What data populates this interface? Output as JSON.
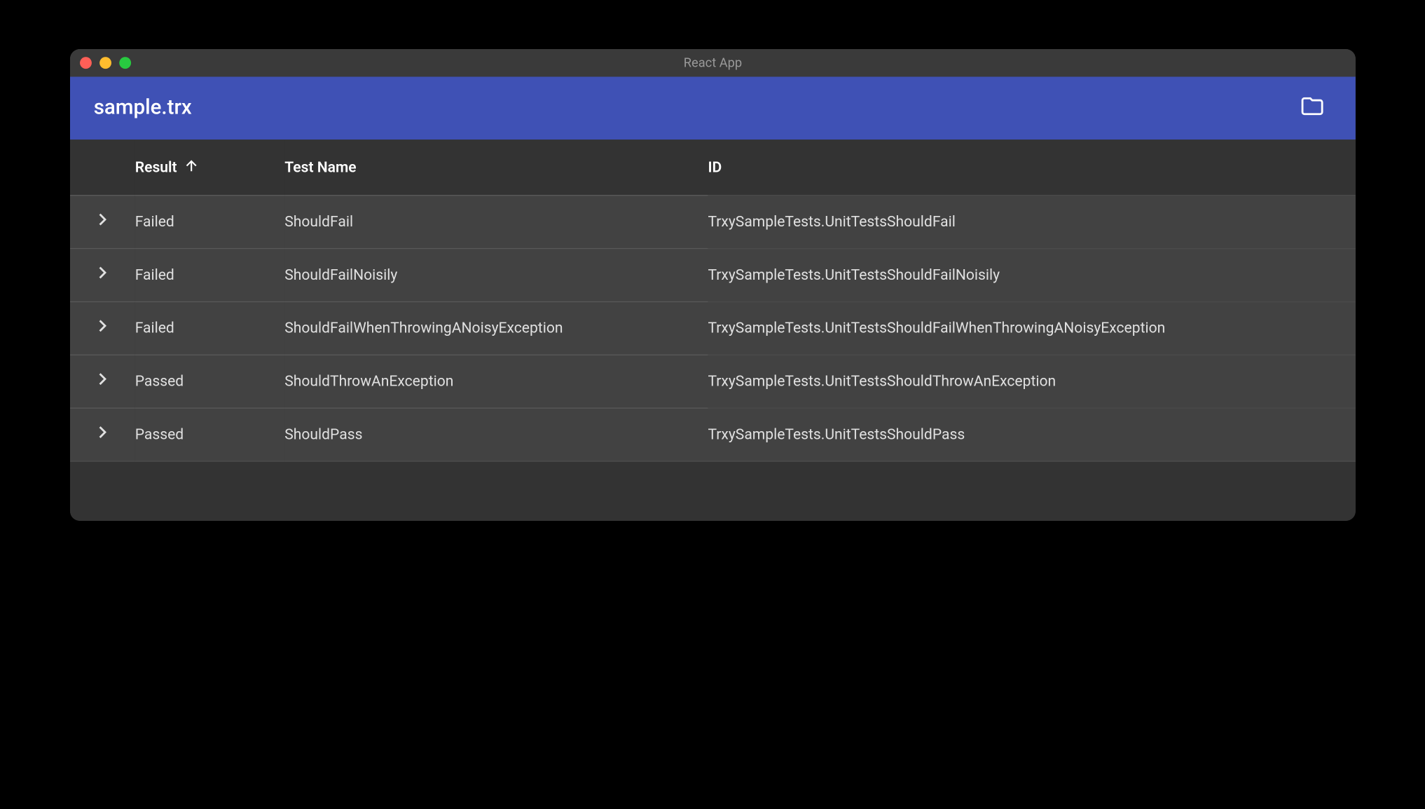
{
  "window": {
    "title": "React App"
  },
  "appbar": {
    "title": "sample.trx"
  },
  "table": {
    "columns": {
      "result": "Result",
      "testname": "Test Name",
      "id": "ID"
    },
    "rows": [
      {
        "result": "Failed",
        "testname": "ShouldFail",
        "id": "TrxySampleTests.UnitTestsShouldFail"
      },
      {
        "result": "Failed",
        "testname": "ShouldFailNoisily",
        "id": "TrxySampleTests.UnitTestsShouldFailNoisily"
      },
      {
        "result": "Failed",
        "testname": "ShouldFailWhenThrowingANoisyException",
        "id": "TrxySampleTests.UnitTestsShouldFailWhenThrowingANoisyException"
      },
      {
        "result": "Passed",
        "testname": "ShouldThrowAnException",
        "id": "TrxySampleTests.UnitTestsShouldThrowAnException"
      },
      {
        "result": "Passed",
        "testname": "ShouldPass",
        "id": "TrxySampleTests.UnitTestsShouldPass"
      }
    ]
  }
}
